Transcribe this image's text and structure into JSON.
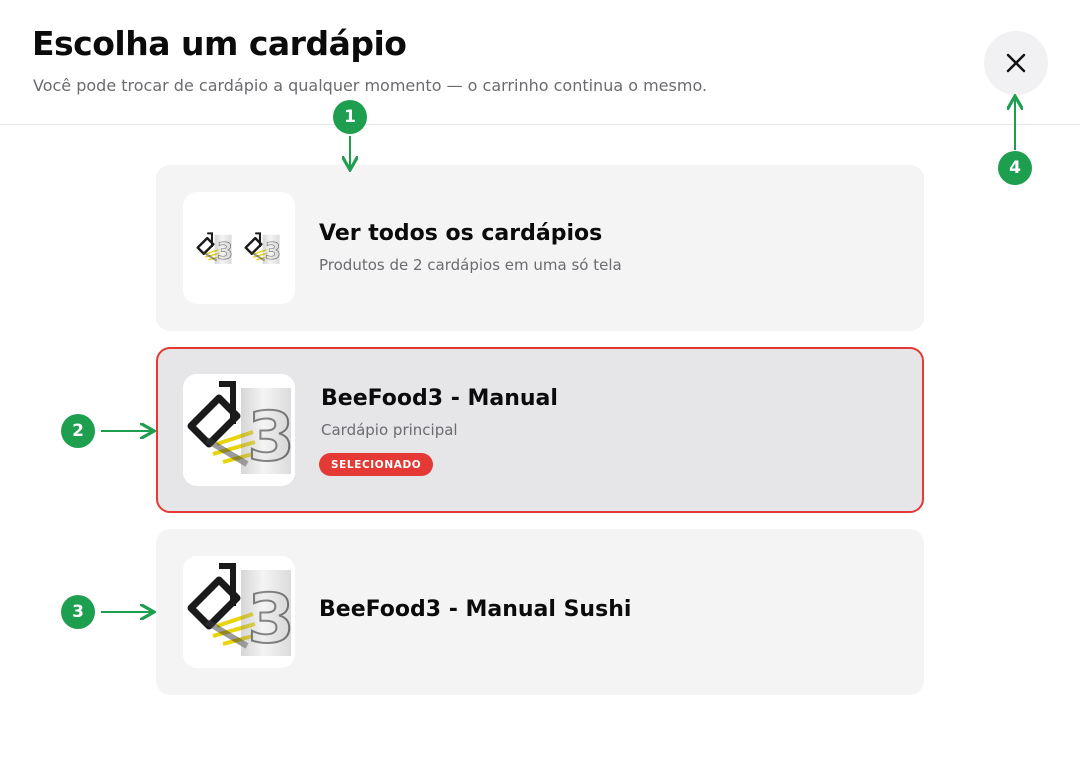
{
  "header": {
    "title": "Escolha um cardápio",
    "subtitle": "Você pode trocar de cardápio a qualquer momento — o carrinho continua o mesmo.",
    "close_icon": "close-icon"
  },
  "menus": [
    {
      "name": "Ver todos os cardápios",
      "description": "Produtos de 2 cardápios em uma só tela",
      "icon": "beefood3-logo-icon",
      "selected": false
    },
    {
      "name": "BeeFood3 - Manual",
      "description": "Cardápio principal",
      "badge": "SELECIONADO",
      "icon": "beefood3-logo-icon",
      "selected": true
    },
    {
      "name": "BeeFood3 - Manual Sushi",
      "icon": "beefood3-logo-icon",
      "selected": false
    }
  ],
  "annotations": {
    "markers": [
      "1",
      "2",
      "3",
      "4"
    ],
    "color": "#1e9e4f"
  },
  "colors": {
    "accent": "#e53935",
    "card_bg": "#f4f4f5",
    "selected_bg": "#e6e6e9"
  }
}
